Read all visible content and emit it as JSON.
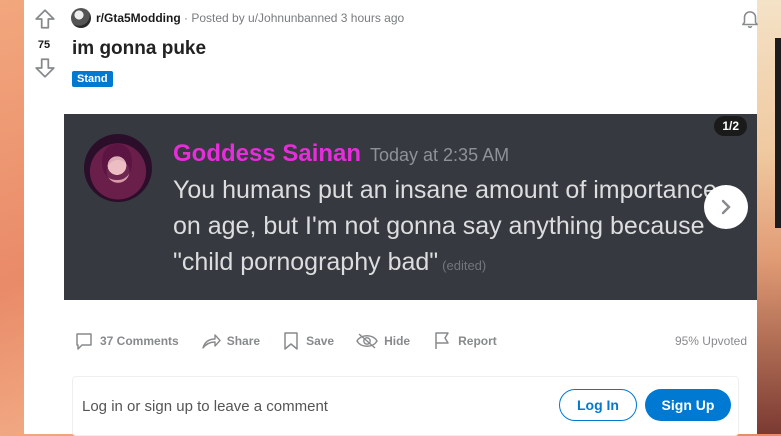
{
  "post": {
    "score": "75",
    "subreddit": "r/Gta5Modding",
    "meta_sep": " · Posted by ",
    "author": "u/Johnunbanned",
    "age": " 3 hours ago",
    "title": "im gonna puke",
    "flair": "Stand"
  },
  "media": {
    "counter": "1/2",
    "display_name": "Goddess Sainan",
    "timestamp": "Today at 2:35 AM",
    "message": "You humans put an insane amount of importance on age, but I'm not gonna say anything because \"child pornography bad\"",
    "edited": "(edited)"
  },
  "actions": {
    "comments": "37 Comments",
    "share": "Share",
    "save": "Save",
    "hide": "Hide",
    "report": "Report",
    "upvoted": "95% Upvoted"
  },
  "comment_box": {
    "prompt": "Log in or sign up to leave a comment",
    "login": "Log In",
    "signup": "Sign Up"
  },
  "colors": {
    "accent": "#0079d3",
    "discord_name": "#e62ddc",
    "media_bg": "#36393f"
  }
}
